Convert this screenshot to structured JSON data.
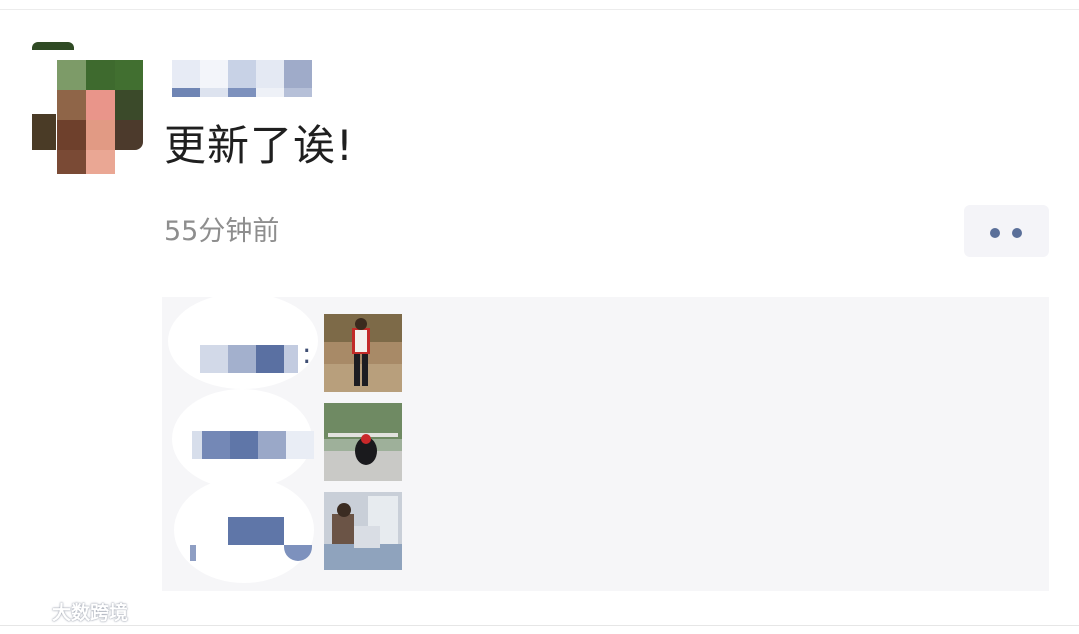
{
  "post": {
    "text": "更新了诶!",
    "timestamp": "55分钟前"
  },
  "comments": [
    {
      "label": ":",
      "thumb": "walking-person-photo"
    },
    {
      "label": "",
      "thumb": "motorbike-photo"
    },
    {
      "label": "",
      "thumb": "people-indoor-photo"
    }
  ],
  "watermark": {
    "text": "大数跨境",
    "logo": "logo-icon"
  },
  "colors": {
    "accent": "#5a6f99",
    "box": "#f6f6f8"
  }
}
